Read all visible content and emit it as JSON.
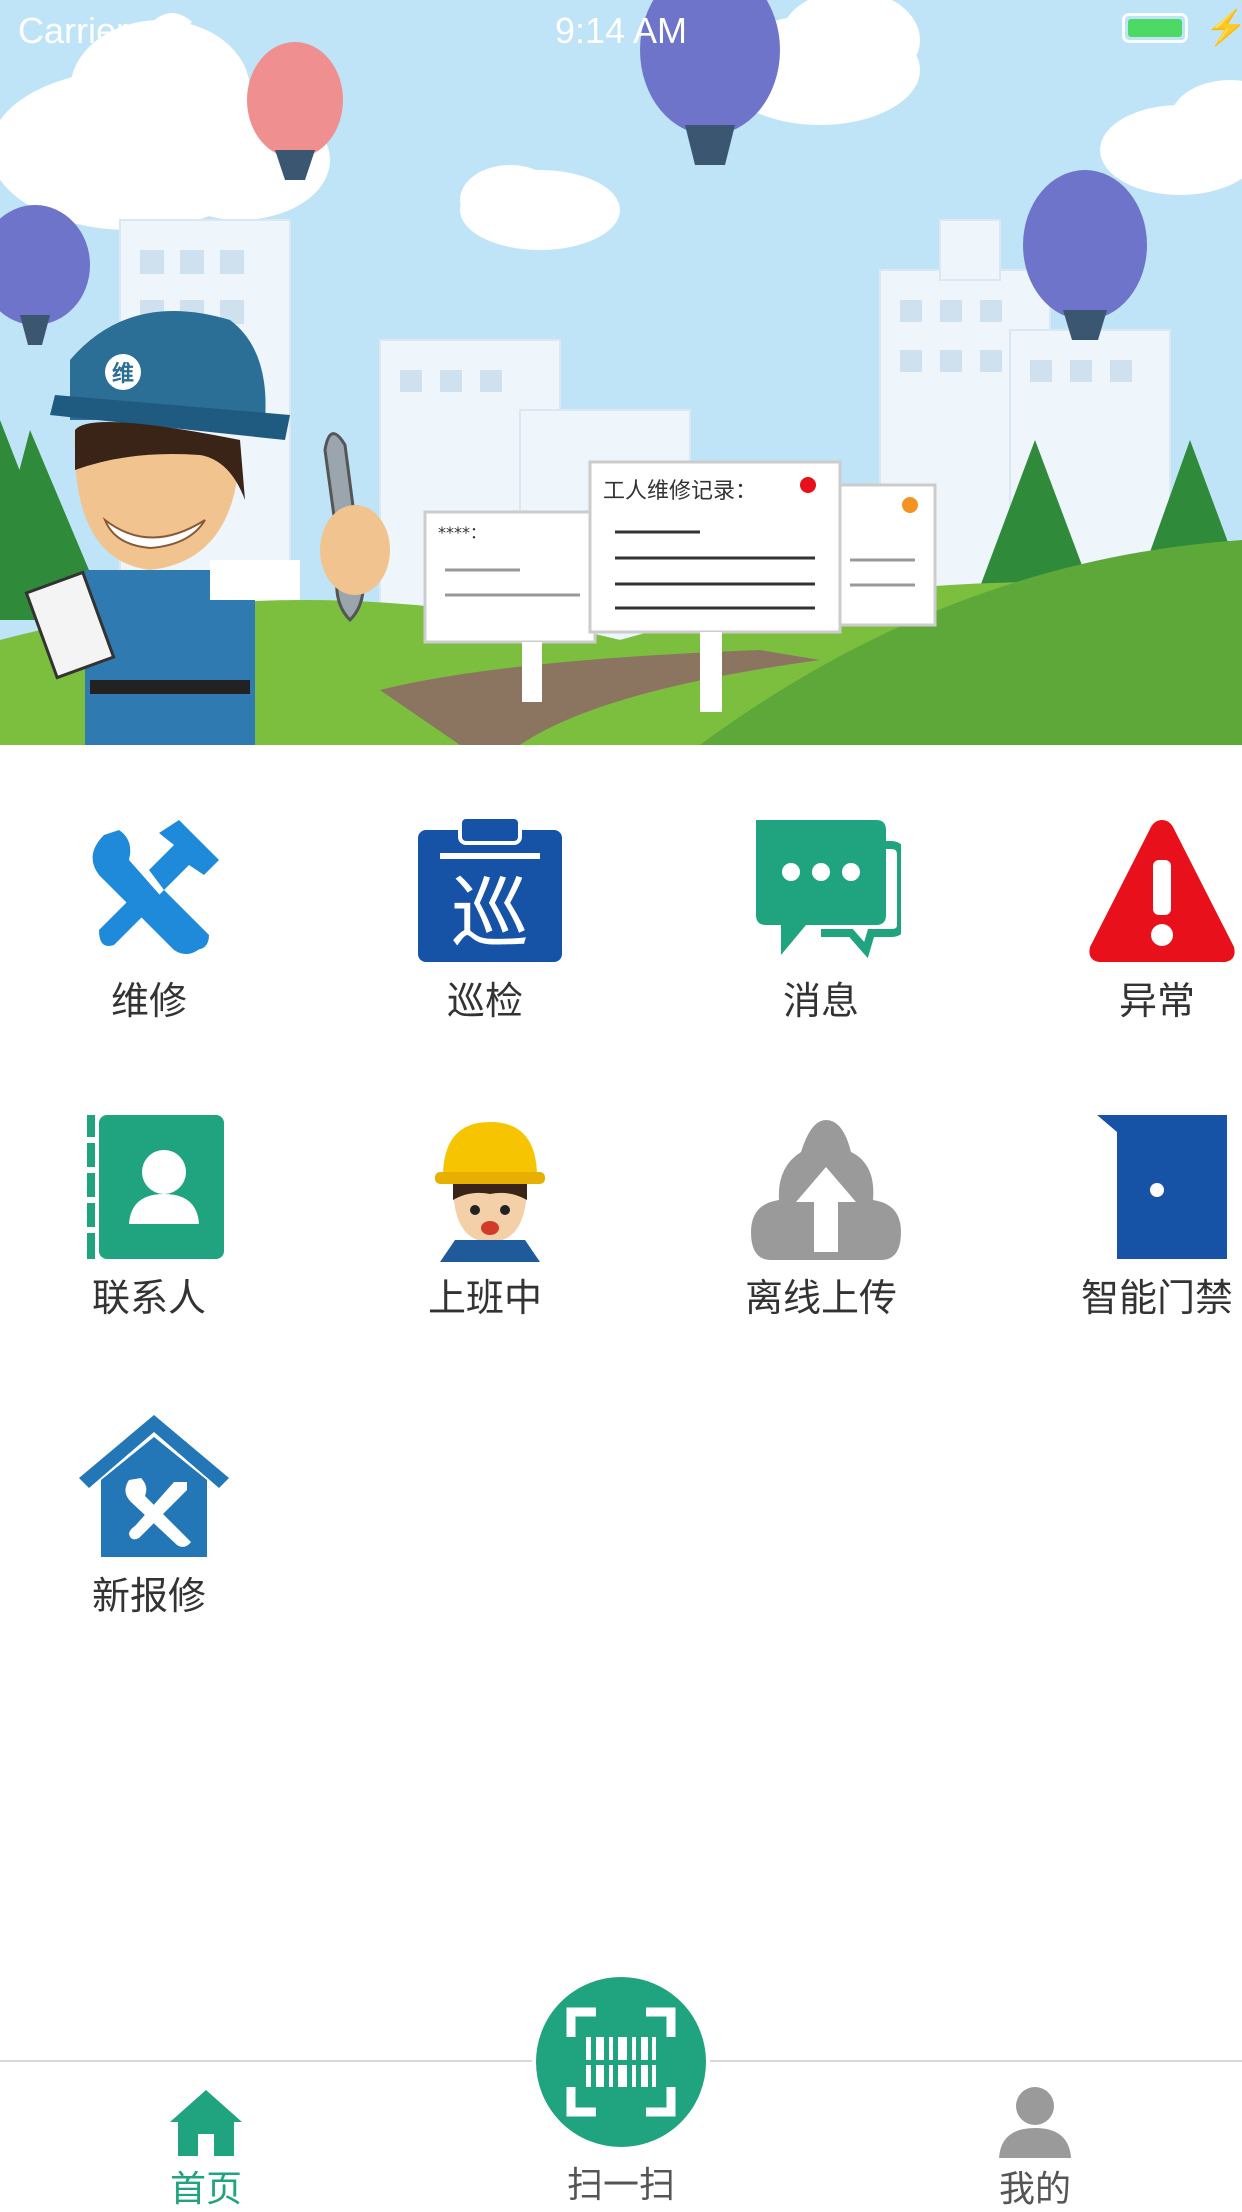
{
  "status_bar": {
    "carrier": "Carrier",
    "time": "9:14 AM"
  },
  "banner": {
    "board_title": "工人维修记录：",
    "board_small": "****：",
    "helmet_text": "维"
  },
  "menu": [
    {
      "id": "repair",
      "label": "维修",
      "icon": "wrench-hammer-icon"
    },
    {
      "id": "inspection",
      "label": "巡检",
      "icon": "clipboard-patrol-icon",
      "icon_text": "巡"
    },
    {
      "id": "messages",
      "label": "消息",
      "icon": "chat-bubbles-icon"
    },
    {
      "id": "exception",
      "label": "异常",
      "icon": "warning-triangle-icon"
    },
    {
      "id": "contacts",
      "label": "联系人",
      "icon": "contact-book-icon"
    },
    {
      "id": "on-duty",
      "label": "上班中",
      "icon": "worker-helmet-icon"
    },
    {
      "id": "offline-upload",
      "label": "离线上传",
      "icon": "cloud-upload-icon"
    },
    {
      "id": "smart-door",
      "label": "智能门禁",
      "icon": "door-icon"
    },
    {
      "id": "new-repair",
      "label": "新报修",
      "icon": "house-tools-icon"
    }
  ],
  "tabbar": {
    "home": {
      "label": "首页",
      "icon": "home-icon",
      "active": true
    },
    "scan": {
      "label": "扫一扫",
      "icon": "barcode-scan-icon"
    },
    "mine": {
      "label": "我的",
      "icon": "person-icon"
    }
  },
  "colors": {
    "accent": "#20a37f",
    "blue": "#1f8ad9",
    "danger": "#e8101a",
    "navy": "#1653a6",
    "gray": "#9a9a9a"
  }
}
